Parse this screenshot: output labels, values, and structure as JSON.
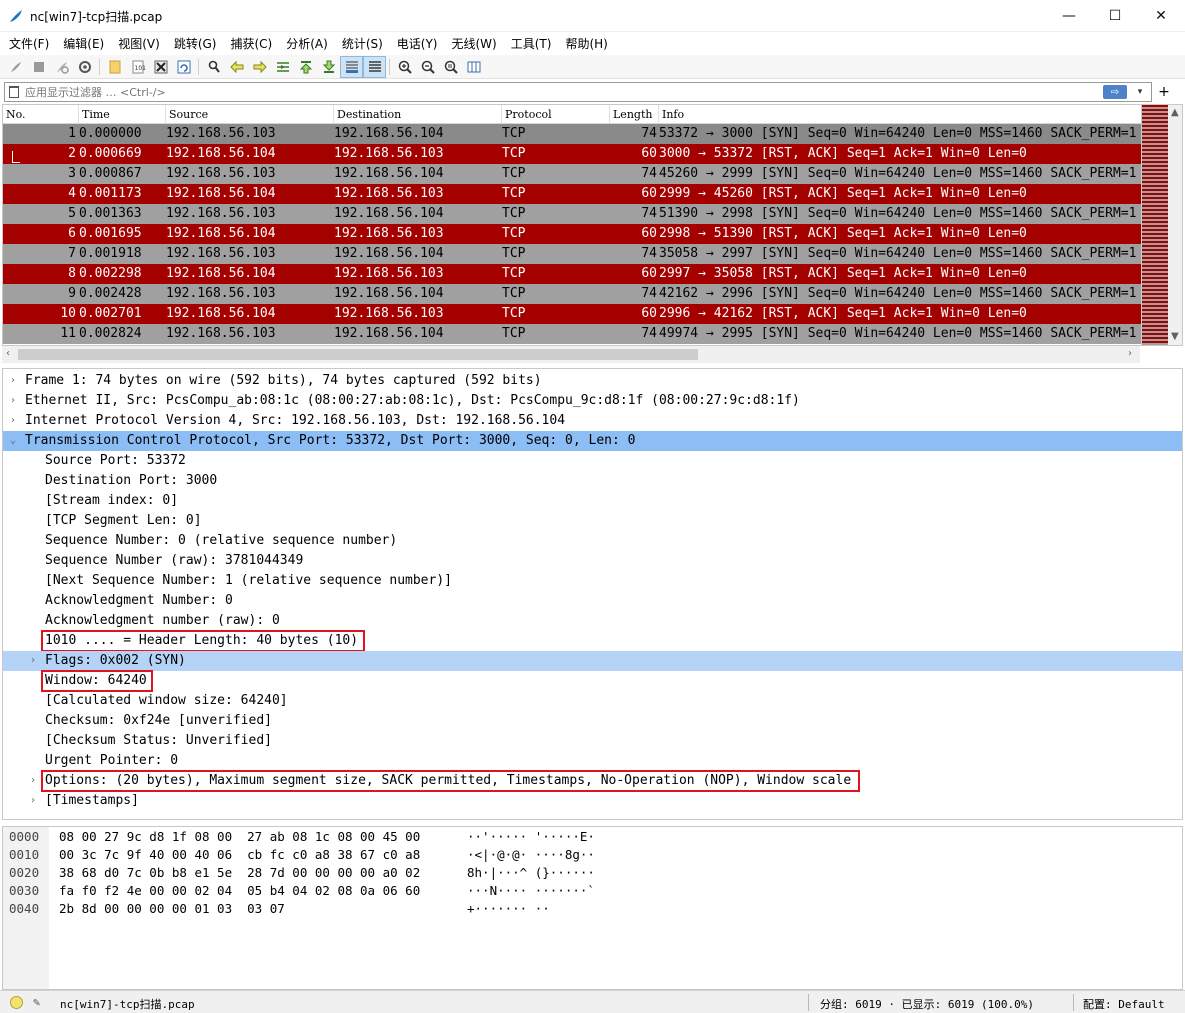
{
  "window": {
    "title": "nc[win7]-tcp扫描.pcap",
    "minimize": "—",
    "maximize": "☐",
    "close": "✕"
  },
  "menu": [
    "文件(F)",
    "编辑(E)",
    "视图(V)",
    "跳转(G)",
    "捕获(C)",
    "分析(A)",
    "统计(S)",
    "电话(Y)",
    "无线(W)",
    "工具(T)",
    "帮助(H)"
  ],
  "filter": {
    "placeholder": "应用显示过滤器 … <Ctrl-/>",
    "apply": "⇨",
    "dropdown": "▾",
    "add": "+"
  },
  "packet_list": {
    "columns": [
      "No.",
      "Time",
      "Source",
      "Destination",
      "Protocol",
      "Length",
      "Info"
    ],
    "rows": [
      {
        "no": "1",
        "time": "0.000000",
        "src": "192.168.56.103",
        "dst": "192.168.56.104",
        "proto": "TCP",
        "len": "74",
        "info": "53372 → 3000 [SYN] Seq=0 Win=64240 Len=0 MSS=1460 SACK_PERM=1",
        "kind": "syn"
      },
      {
        "no": "2",
        "time": "0.000669",
        "src": "192.168.56.104",
        "dst": "192.168.56.103",
        "proto": "TCP",
        "len": "60",
        "info": "3000 → 53372 [RST, ACK] Seq=1 Ack=1 Win=0 Len=0",
        "kind": "rst"
      },
      {
        "no": "3",
        "time": "0.000867",
        "src": "192.168.56.103",
        "dst": "192.168.56.104",
        "proto": "TCP",
        "len": "74",
        "info": "45260 → 2999 [SYN] Seq=0 Win=64240 Len=0 MSS=1460 SACK_PERM=1",
        "kind": "syn"
      },
      {
        "no": "4",
        "time": "0.001173",
        "src": "192.168.56.104",
        "dst": "192.168.56.103",
        "proto": "TCP",
        "len": "60",
        "info": "2999 → 45260 [RST, ACK] Seq=1 Ack=1 Win=0 Len=0",
        "kind": "rst"
      },
      {
        "no": "5",
        "time": "0.001363",
        "src": "192.168.56.103",
        "dst": "192.168.56.104",
        "proto": "TCP",
        "len": "74",
        "info": "51390 → 2998 [SYN] Seq=0 Win=64240 Len=0 MSS=1460 SACK_PERM=1",
        "kind": "syn"
      },
      {
        "no": "6",
        "time": "0.001695",
        "src": "192.168.56.104",
        "dst": "192.168.56.103",
        "proto": "TCP",
        "len": "60",
        "info": "2998 → 51390 [RST, ACK] Seq=1 Ack=1 Win=0 Len=0",
        "kind": "rst"
      },
      {
        "no": "7",
        "time": "0.001918",
        "src": "192.168.56.103",
        "dst": "192.168.56.104",
        "proto": "TCP",
        "len": "74",
        "info": "35058 → 2997 [SYN] Seq=0 Win=64240 Len=0 MSS=1460 SACK_PERM=1",
        "kind": "syn"
      },
      {
        "no": "8",
        "time": "0.002298",
        "src": "192.168.56.104",
        "dst": "192.168.56.103",
        "proto": "TCP",
        "len": "60",
        "info": "2997 → 35058 [RST, ACK] Seq=1 Ack=1 Win=0 Len=0",
        "kind": "rst"
      },
      {
        "no": "9",
        "time": "0.002428",
        "src": "192.168.56.103",
        "dst": "192.168.56.104",
        "proto": "TCP",
        "len": "74",
        "info": "42162 → 2996 [SYN] Seq=0 Win=64240 Len=0 MSS=1460 SACK_PERM=1",
        "kind": "syn"
      },
      {
        "no": "10",
        "time": "0.002701",
        "src": "192.168.56.104",
        "dst": "192.168.56.103",
        "proto": "TCP",
        "len": "60",
        "info": "2996 → 42162 [RST, ACK] Seq=1 Ack=1 Win=0 Len=0",
        "kind": "rst"
      },
      {
        "no": "11",
        "time": "0.002824",
        "src": "192.168.56.103",
        "dst": "192.168.56.104",
        "proto": "TCP",
        "len": "74",
        "info": "49974 → 2995 [SYN] Seq=0 Win=64240 Len=0 MSS=1460 SACK_PERM=1",
        "kind": "syn"
      }
    ]
  },
  "details": [
    {
      "text": "Frame 1: 74 bytes on wire (592 bits), 74 bytes captured (592 bits)",
      "level": 0,
      "expander": "›"
    },
    {
      "text": "Ethernet II, Src: PcsCompu_ab:08:1c (08:00:27:ab:08:1c), Dst: PcsCompu_9c:d8:1f (08:00:27:9c:d8:1f)",
      "level": 0,
      "expander": "›"
    },
    {
      "text": "Internet Protocol Version 4, Src: 192.168.56.103, Dst: 192.168.56.104",
      "level": 0,
      "expander": "›"
    },
    {
      "text": "Transmission Control Protocol, Src Port: 53372, Dst Port: 3000, Seq: 0, Len: 0",
      "level": 0,
      "expander": "⌄",
      "state": "sel"
    },
    {
      "text": "Source Port: 53372",
      "level": 1
    },
    {
      "text": "Destination Port: 3000",
      "level": 1
    },
    {
      "text": "[Stream index: 0]",
      "level": 1
    },
    {
      "text": "[TCP Segment Len: 0]",
      "level": 1
    },
    {
      "text": "Sequence Number: 0    (relative sequence number)",
      "level": 1
    },
    {
      "text": "Sequence Number (raw): 3781044349",
      "level": 1
    },
    {
      "text": "[Next Sequence Number: 1    (relative sequence number)]",
      "level": 1
    },
    {
      "text": "Acknowledgment Number: 0",
      "level": 1
    },
    {
      "text": "Acknowledgment number (raw): 0",
      "level": 1
    },
    {
      "text": "1010 .... = Header Length: 40 bytes (10)",
      "level": 1,
      "boxed": true
    },
    {
      "text": "Flags: 0x002 (SYN)",
      "level": 1,
      "expander": "›",
      "state": "hl"
    },
    {
      "text": "Window: 64240",
      "level": 1,
      "boxed": true
    },
    {
      "text": "[Calculated window size: 64240]",
      "level": 1
    },
    {
      "text": "Checksum: 0xf24e [unverified]",
      "level": 1
    },
    {
      "text": "[Checksum Status: Unverified]",
      "level": 1
    },
    {
      "text": "Urgent Pointer: 0",
      "level": 1
    },
    {
      "text": "Options: (20 bytes), Maximum segment size, SACK permitted, Timestamps, No-Operation (NOP), Window scale",
      "level": 1,
      "expander": "›",
      "boxed": true
    },
    {
      "text": "[Timestamps]",
      "level": 1,
      "expander": "›"
    }
  ],
  "bytes": [
    {
      "offset": "0000",
      "hex": "08 00 27 9c d8 1f 08 00  27 ab 08 1c 08 00 45 00",
      "ascii": "··'····· '·····E·"
    },
    {
      "offset": "0010",
      "hex": "00 3c 7c 9f 40 00 40 06  cb fc c0 a8 38 67 c0 a8",
      "ascii": "·<|·@·@· ····8g··"
    },
    {
      "offset": "0020",
      "hex": "38 68 d0 7c 0b b8 e1 5e  28 7d 00 00 00 00 a0 02",
      "ascii": "8h·|···^ (}······"
    },
    {
      "offset": "0030",
      "hex": "fa f0 f2 4e 00 00 02 04  05 b4 04 02 08 0a 06 60",
      "ascii": "···N···· ·······`"
    },
    {
      "offset": "0040",
      "hex": "2b 8d 00 00 00 00 01 03  03 07",
      "ascii": "+······· ··"
    }
  ],
  "status": {
    "file": "nc[win7]-tcp扫描.pcap",
    "stats": "分组: 6019 · 已显示: 6019 (100.0%)",
    "profile": "配置: Default"
  }
}
